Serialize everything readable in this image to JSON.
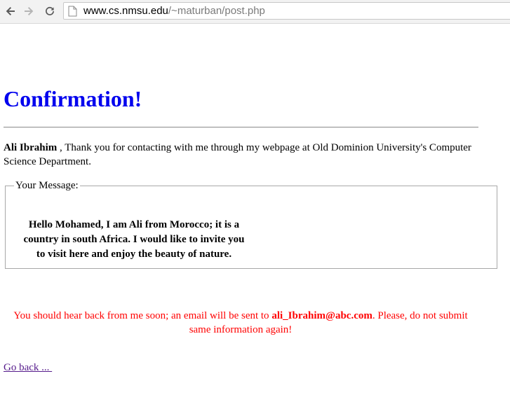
{
  "browser": {
    "url_domain": "www.cs.nmsu.edu",
    "url_path": "/~maturban/post.php",
    "icons": [
      "back-arrow-icon",
      "forward-arrow-icon",
      "reload-icon",
      "page-icon"
    ]
  },
  "page": {
    "title": "Confirmation!",
    "title_color": "#0000ee",
    "sender_name": "Ali Ibrahim",
    "thanks_text": " , Thank you for contacting with me through my webpage at Old Dominion University's Computer Science Department.",
    "fieldset_legend": "Your Message:",
    "message": "Hello Mohamed, I am Ali from Morocco; it is a country in south Africa. I would like to invite you to visit here and enjoy the beauty of nature.",
    "notice_before": "You should hear back from me soon; an email will be sent to ",
    "notice_email": "ali_Ibrahim@abc.com",
    "notice_after": ". Please, do not submit same information again!",
    "notice_color": "#ff0000",
    "back_link": "Go back ... "
  }
}
